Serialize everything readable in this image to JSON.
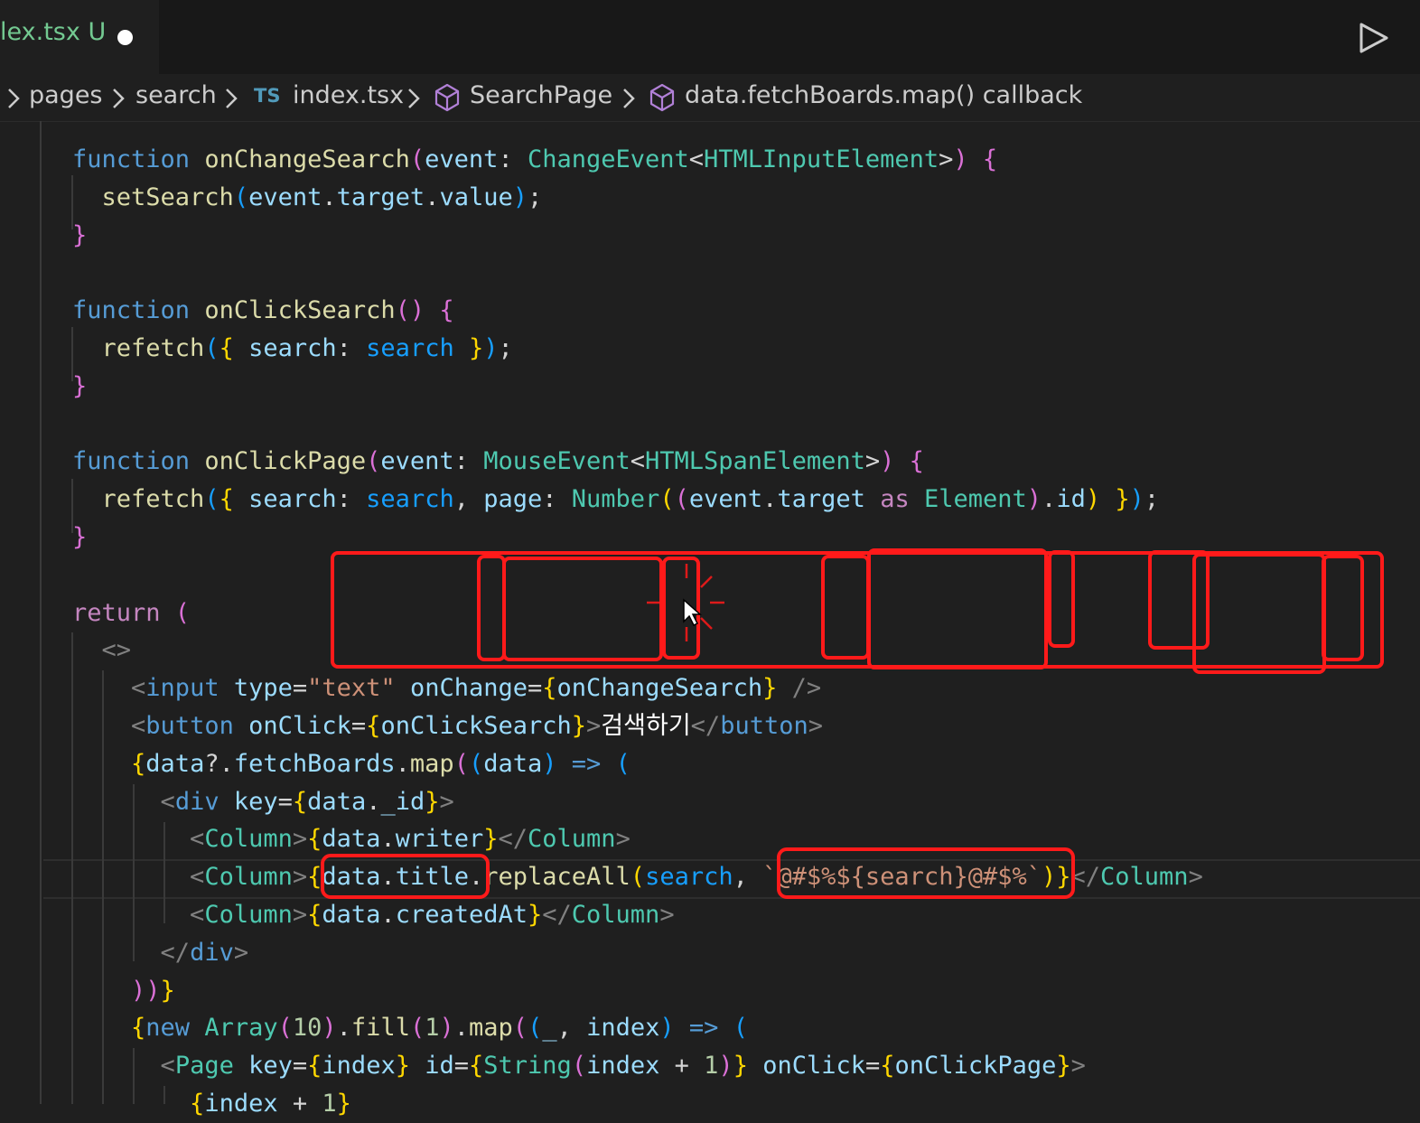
{
  "tab": {
    "filename": "lex.tsx",
    "status": "U"
  },
  "breadcrumbs": {
    "items": [
      "pages",
      "search",
      "index.tsx",
      "SearchPage",
      "data.fetchBoards.map() callback"
    ],
    "file_badge": "TS"
  },
  "icons": [
    "run-icon",
    "chevron-right-icon",
    "symbol-method-icon",
    "typescript-icon"
  ],
  "colors": {
    "keyword": "#569cd6",
    "function": "#dcdcaa",
    "type": "#4ec9b0",
    "variable": "#9cdcfe",
    "string": "#ce9178",
    "annotation": "#ff1a1a",
    "modified": "#73c991"
  },
  "code_lines": [
    [
      [
        "function ",
        "k"
      ],
      [
        "onChangeSearch",
        "f"
      ],
      [
        "(",
        "b2"
      ],
      [
        "event",
        "v"
      ],
      [
        ": ",
        "p"
      ],
      [
        "ChangeEvent",
        "t"
      ],
      [
        "<",
        "p"
      ],
      [
        "HTMLInputElement",
        "t"
      ],
      [
        ">",
        "p"
      ],
      [
        ")",
        "b2"
      ],
      [
        " ",
        "p"
      ],
      [
        "{",
        "b2"
      ]
    ],
    [
      [
        "  ",
        "p"
      ],
      [
        "setSearch",
        "f"
      ],
      [
        "(",
        "b3"
      ],
      [
        "event",
        "v"
      ],
      [
        ".",
        "p"
      ],
      [
        "target",
        "v"
      ],
      [
        ".",
        "p"
      ],
      [
        "value",
        "v"
      ],
      [
        ")",
        "b3"
      ],
      [
        ";",
        "p"
      ]
    ],
    [
      [
        "}",
        "b2"
      ]
    ],
    [],
    [
      [
        "function ",
        "k"
      ],
      [
        "onClickSearch",
        "f"
      ],
      [
        "()",
        "b2"
      ],
      [
        " ",
        "p"
      ],
      [
        "{",
        "b2"
      ]
    ],
    [
      [
        "  ",
        "p"
      ],
      [
        "refetch",
        "f"
      ],
      [
        "(",
        "b3"
      ],
      [
        "{",
        "b1"
      ],
      [
        " ",
        "p"
      ],
      [
        "search",
        "v"
      ],
      [
        ": ",
        "p"
      ],
      [
        "search",
        "b3"
      ],
      [
        " ",
        "p"
      ],
      [
        "}",
        "b1"
      ],
      [
        ")",
        "b3"
      ],
      [
        ";",
        "p"
      ]
    ],
    [
      [
        "}",
        "b2"
      ]
    ],
    [],
    [
      [
        "function ",
        "k"
      ],
      [
        "onClickPage",
        "f"
      ],
      [
        "(",
        "b2"
      ],
      [
        "event",
        "v"
      ],
      [
        ": ",
        "p"
      ],
      [
        "MouseEvent",
        "t"
      ],
      [
        "<",
        "p"
      ],
      [
        "HTMLSpanElement",
        "t"
      ],
      [
        ">",
        "p"
      ],
      [
        ")",
        "b2"
      ],
      [
        " ",
        "p"
      ],
      [
        "{",
        "b2"
      ]
    ],
    [
      [
        "  ",
        "p"
      ],
      [
        "refetch",
        "f"
      ],
      [
        "(",
        "b3"
      ],
      [
        "{",
        "b1"
      ],
      [
        " ",
        "p"
      ],
      [
        "search",
        "v"
      ],
      [
        ": ",
        "p"
      ],
      [
        "search",
        "b3"
      ],
      [
        ", ",
        "p"
      ],
      [
        "page",
        "v"
      ],
      [
        ": ",
        "p"
      ],
      [
        "Number",
        "t"
      ],
      [
        "(",
        "b1"
      ],
      [
        "(",
        "b2"
      ],
      [
        "event",
        "v"
      ],
      [
        ".",
        "p"
      ],
      [
        "target",
        "v"
      ],
      [
        " as ",
        "r"
      ],
      [
        "Element",
        "t"
      ],
      [
        ")",
        "b2"
      ],
      [
        ".",
        "p"
      ],
      [
        "id",
        "v"
      ],
      [
        ")",
        "b1"
      ],
      [
        " ",
        "p"
      ],
      [
        "}",
        "b1"
      ],
      [
        ")",
        "b3"
      ],
      [
        ";",
        "p"
      ]
    ],
    [
      [
        "}",
        "b2"
      ]
    ],
    [],
    [
      [
        "return ",
        "r"
      ],
      [
        "(",
        "b2"
      ]
    ],
    [
      [
        "  ",
        "p"
      ],
      [
        "<>",
        "g"
      ]
    ],
    [
      [
        "    ",
        "p"
      ],
      [
        "<",
        "g"
      ],
      [
        "input",
        "k"
      ],
      [
        " ",
        "p"
      ],
      [
        "type",
        "v"
      ],
      [
        "=",
        "p"
      ],
      [
        "\"text\"",
        "s"
      ],
      [
        " ",
        "p"
      ],
      [
        "onChange",
        "v"
      ],
      [
        "=",
        "p"
      ],
      [
        "{",
        "b1"
      ],
      [
        "onChangeSearch",
        "v"
      ],
      [
        "}",
        "b1"
      ],
      [
        " />",
        "g"
      ]
    ],
    [
      [
        "    ",
        "p"
      ],
      [
        "<",
        "g"
      ],
      [
        "button",
        "k"
      ],
      [
        " ",
        "p"
      ],
      [
        "onClick",
        "v"
      ],
      [
        "=",
        "p"
      ],
      [
        "{",
        "b1"
      ],
      [
        "onClickSearch",
        "v"
      ],
      [
        "}",
        "b1"
      ],
      [
        ">",
        "g"
      ],
      [
        "검색하기",
        "w"
      ],
      [
        "</",
        "g"
      ],
      [
        "button",
        "k"
      ],
      [
        ">",
        "g"
      ]
    ],
    [
      [
        "    ",
        "p"
      ],
      [
        "{",
        "b1"
      ],
      [
        "data",
        "v"
      ],
      [
        "?.",
        "p"
      ],
      [
        "fetchBoards",
        "v"
      ],
      [
        ".",
        "p"
      ],
      [
        "map",
        "f"
      ],
      [
        "(",
        "b2"
      ],
      [
        "(",
        "b3"
      ],
      [
        "data",
        "v"
      ],
      [
        ")",
        "b3"
      ],
      [
        " => ",
        "k"
      ],
      [
        "(",
        "b3"
      ]
    ],
    [
      [
        "      ",
        "p"
      ],
      [
        "<",
        "g"
      ],
      [
        "div",
        "k"
      ],
      [
        " ",
        "p"
      ],
      [
        "key",
        "v"
      ],
      [
        "=",
        "p"
      ],
      [
        "{",
        "b1"
      ],
      [
        "data",
        "v"
      ],
      [
        ".",
        "p"
      ],
      [
        "_id",
        "v"
      ],
      [
        "}",
        "b1"
      ],
      [
        ">",
        "g"
      ]
    ],
    [
      [
        "        ",
        "p"
      ],
      [
        "<",
        "g"
      ],
      [
        "Column",
        "t"
      ],
      [
        ">",
        "g"
      ],
      [
        "{",
        "b1"
      ],
      [
        "data",
        "v"
      ],
      [
        ".",
        "p"
      ],
      [
        "writer",
        "v"
      ],
      [
        "}",
        "b1"
      ],
      [
        "</",
        "g"
      ],
      [
        "Column",
        "t"
      ],
      [
        ">",
        "g"
      ]
    ],
    [
      [
        "        ",
        "p"
      ],
      [
        "<",
        "g"
      ],
      [
        "Column",
        "t"
      ],
      [
        ">",
        "g"
      ],
      [
        "{",
        "b1"
      ],
      [
        "data",
        "v"
      ],
      [
        ".",
        "p"
      ],
      [
        "title",
        "v"
      ],
      [
        ".",
        "p"
      ],
      [
        "replaceAll",
        "f"
      ],
      [
        "(",
        "b1"
      ],
      [
        "search",
        "b3"
      ],
      [
        ", ",
        "p"
      ],
      [
        "`@#$%${search}@#$%`",
        "s"
      ],
      [
        ")",
        "b1"
      ],
      [
        "}",
        "b1"
      ],
      [
        "</",
        "g"
      ],
      [
        "Column",
        "t"
      ],
      [
        ">",
        "g"
      ]
    ],
    [
      [
        "        ",
        "p"
      ],
      [
        "<",
        "g"
      ],
      [
        "Column",
        "t"
      ],
      [
        ">",
        "g"
      ],
      [
        "{",
        "b1"
      ],
      [
        "data",
        "v"
      ],
      [
        ".",
        "p"
      ],
      [
        "createdAt",
        "v"
      ],
      [
        "}",
        "b1"
      ],
      [
        "</",
        "g"
      ],
      [
        "Column",
        "t"
      ],
      [
        ">",
        "g"
      ]
    ],
    [
      [
        "      ",
        "p"
      ],
      [
        "</",
        "g"
      ],
      [
        "div",
        "k"
      ],
      [
        ">",
        "g"
      ]
    ],
    [
      [
        "    ",
        "p"
      ],
      [
        "))",
        "b2"
      ],
      [
        "}",
        "b1"
      ]
    ],
    [
      [
        "    ",
        "p"
      ],
      [
        "{",
        "b1"
      ],
      [
        "new ",
        "k"
      ],
      [
        "Array",
        "t"
      ],
      [
        "(",
        "b2"
      ],
      [
        "10",
        "n"
      ],
      [
        ")",
        "b2"
      ],
      [
        ".",
        "p"
      ],
      [
        "fill",
        "f"
      ],
      [
        "(",
        "b2"
      ],
      [
        "1",
        "n"
      ],
      [
        ")",
        "b2"
      ],
      [
        ".",
        "p"
      ],
      [
        "map",
        "f"
      ],
      [
        "(",
        "b2"
      ],
      [
        "(",
        "b3"
      ],
      [
        "_",
        "v"
      ],
      [
        ", ",
        "p"
      ],
      [
        "index",
        "v"
      ],
      [
        ")",
        "b3"
      ],
      [
        " => ",
        "k"
      ],
      [
        "(",
        "b3"
      ]
    ],
    [
      [
        "      ",
        "p"
      ],
      [
        "<",
        "g"
      ],
      [
        "Page",
        "t"
      ],
      [
        " ",
        "p"
      ],
      [
        "key",
        "v"
      ],
      [
        "=",
        "p"
      ],
      [
        "{",
        "b1"
      ],
      [
        "index",
        "v"
      ],
      [
        "}",
        "b1"
      ],
      [
        " ",
        "p"
      ],
      [
        "id",
        "v"
      ],
      [
        "=",
        "p"
      ],
      [
        "{",
        "b1"
      ],
      [
        "String",
        "t"
      ],
      [
        "(",
        "b2"
      ],
      [
        "index",
        "v"
      ],
      [
        " + ",
        "p"
      ],
      [
        "1",
        "n"
      ],
      [
        ")",
        "b2"
      ],
      [
        "}",
        "b1"
      ],
      [
        " ",
        "p"
      ],
      [
        "onClick",
        "v"
      ],
      [
        "=",
        "p"
      ],
      [
        "{",
        "b1"
      ],
      [
        "onClickPage",
        "v"
      ],
      [
        "}",
        "b1"
      ],
      [
        ">",
        "g"
      ]
    ],
    [
      [
        "        ",
        "p"
      ],
      [
        "{",
        "b1"
      ],
      [
        "index",
        "v"
      ],
      [
        " + ",
        "p"
      ],
      [
        "1",
        "n"
      ],
      [
        "}",
        "b1"
      ]
    ]
  ]
}
